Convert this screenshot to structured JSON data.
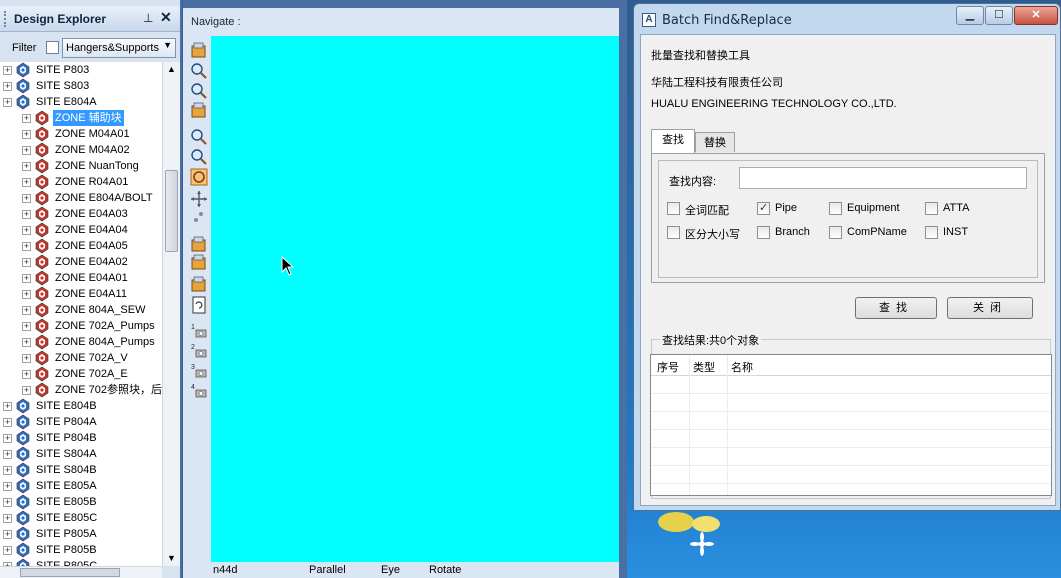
{
  "design_explorer": {
    "title": "Design Explorer",
    "pin_icon": "pin-icon",
    "close_icon": "close-icon",
    "filter_label": "Filter",
    "filter_value": "Hangers&Supports",
    "tree": [
      {
        "label": "SITE P803",
        "level": 0,
        "selected": false
      },
      {
        "label": "SITE S803",
        "level": 0,
        "selected": false
      },
      {
        "label": "SITE E804A",
        "level": 0,
        "selected": false
      },
      {
        "label": "ZONE 辅助块",
        "level": 1,
        "selected": true
      },
      {
        "label": "ZONE M04A01",
        "level": 1,
        "selected": false
      },
      {
        "label": "ZONE M04A02",
        "level": 1,
        "selected": false
      },
      {
        "label": "ZONE NuanTong",
        "level": 1,
        "selected": false
      },
      {
        "label": "ZONE R04A01",
        "level": 1,
        "selected": false
      },
      {
        "label": "ZONE E804A/BOLT",
        "level": 1,
        "selected": false
      },
      {
        "label": "ZONE E04A03",
        "level": 1,
        "selected": false
      },
      {
        "label": "ZONE E04A04",
        "level": 1,
        "selected": false
      },
      {
        "label": "ZONE E04A05",
        "level": 1,
        "selected": false
      },
      {
        "label": "ZONE E04A02",
        "level": 1,
        "selected": false
      },
      {
        "label": "ZONE E04A01",
        "level": 1,
        "selected": false
      },
      {
        "label": "ZONE E04A11",
        "level": 1,
        "selected": false
      },
      {
        "label": "ZONE 804A_SEW",
        "level": 1,
        "selected": false
      },
      {
        "label": "ZONE 702A_Pumps",
        "level": 1,
        "selected": false
      },
      {
        "label": "ZONE 804A_Pumps",
        "level": 1,
        "selected": false
      },
      {
        "label": "ZONE 702A_V",
        "level": 1,
        "selected": false
      },
      {
        "label": "ZONE 702A_E",
        "level": 1,
        "selected": false
      },
      {
        "label": "ZONE 702参照块，后",
        "level": 1,
        "selected": false
      },
      {
        "label": "SITE E804B",
        "level": 0,
        "selected": false
      },
      {
        "label": "SITE P804A",
        "level": 0,
        "selected": false
      },
      {
        "label": "SITE P804B",
        "level": 0,
        "selected": false
      },
      {
        "label": "SITE S804A",
        "level": 0,
        "selected": false
      },
      {
        "label": "SITE S804B",
        "level": 0,
        "selected": false
      },
      {
        "label": "SITE E805A",
        "level": 0,
        "selected": false
      },
      {
        "label": "SITE E805B",
        "level": 0,
        "selected": false
      },
      {
        "label": "SITE E805C",
        "level": 0,
        "selected": false
      },
      {
        "label": "SITE P805A",
        "level": 0,
        "selected": false
      },
      {
        "label": "SITE P805B",
        "level": 0,
        "selected": false
      },
      {
        "label": "SITE P805C",
        "level": 0,
        "selected": false
      }
    ]
  },
  "navigate": {
    "title": "Navigate :",
    "canvas_color": "#00ffff",
    "toolbar_icons": [
      "walk-icon",
      "zoom-region-icon",
      "zoom-limits-icon",
      "view-box-icon",
      "zoom-in-icon",
      "zoom-out-icon",
      "orbit-icon",
      "pan-icon",
      "fly-icon",
      "clip-icon",
      "clip-de-icon",
      "section-icon",
      "refresh-icon",
      "camera-1-icon",
      "camera-2-icon",
      "camera-3-icon",
      "camera-4-icon"
    ],
    "status": {
      "view": "n44d",
      "projection": "Parallel",
      "mode": "Eye",
      "action": "Rotate"
    }
  },
  "batch_dialog": {
    "title": "Batch Find&Replace",
    "app_icon_letter": "A",
    "minimize_icon": "minimize-icon",
    "maximize_icon": "maximize-icon",
    "close_icon": "close-icon",
    "subtitle": "批量查找和替换工具",
    "company_cn": "华陆工程科技有限责任公司",
    "company_en": "HUALU ENGINEERING TECHNOLOGY CO.,LTD.",
    "tabs": [
      {
        "label": "查找",
        "active": true
      },
      {
        "label": "替换",
        "active": false
      }
    ],
    "find_label": "查找内容:",
    "find_value": "",
    "checkboxes": [
      {
        "label": "全词匹配",
        "checked": false
      },
      {
        "label": "Pipe",
        "checked": true
      },
      {
        "label": "Equipment",
        "checked": false
      },
      {
        "label": "ATTA",
        "checked": false
      },
      {
        "label": "区分大小写",
        "checked": false
      },
      {
        "label": "Branch",
        "checked": false
      },
      {
        "label": "ComPName",
        "checked": false
      },
      {
        "label": "INST",
        "checked": false
      }
    ],
    "find_button": "查找",
    "close_button": "关闭",
    "results_label": "查找结果:共0个对象",
    "columns": [
      "序号",
      "类型",
      "名称"
    ]
  }
}
